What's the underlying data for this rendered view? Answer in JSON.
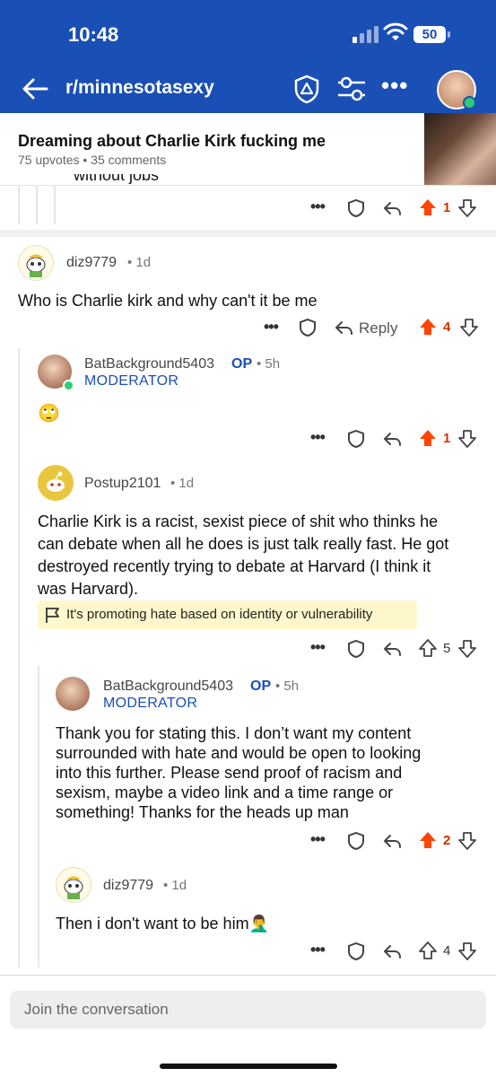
{
  "status_bar": {
    "time": "10:48",
    "battery": "50"
  },
  "header": {
    "subreddit": "r/minnesotasexy"
  },
  "post": {
    "title": "Dreaming about Charlie Kirk fucking me",
    "meta": "75 upvotes • 35 comments"
  },
  "partial_comment": {
    "text": "without jobs",
    "votes": "1"
  },
  "comments": [
    {
      "user": "diz9779",
      "age": "• 1d",
      "text": "Who is Charlie kirk and why can't it be me",
      "reply_label": "Reply",
      "votes": "4"
    },
    {
      "user": "BatBackground5403",
      "op": "OP",
      "age": "• 5h",
      "flair": "MODERATOR",
      "text": "🙄",
      "votes": "1"
    },
    {
      "user": "Postup2101",
      "age": "• 1d",
      "text_lines": [
        "Charlie Kirk is a racist, sexist piece of shit who thinks he",
        "can debate when all he does is just talk really fast. He got",
        "destroyed recently trying to debate at Harvard (I think it",
        "was Harvard)."
      ],
      "reason": "It's promoting hate based on identity or vulnerability",
      "votes": "5"
    },
    {
      "user": "BatBackground5403",
      "op": "OP",
      "age": "• 5h",
      "flair": "MODERATOR",
      "text_lines": [
        "Thank you for stating this.  I don’t want my content",
        "surrounded with hate and would be open to looking",
        "into this further.  Please send proof of racism and",
        "sexism, maybe a video link and a time range or",
        "something! Thanks for the heads up man"
      ],
      "votes": "2"
    },
    {
      "user": "diz9779",
      "age": "• 1d",
      "text": "Then i don't want to be him🤦‍♂️",
      "votes": "4"
    }
  ],
  "composer": {
    "placeholder": "Join the conversation"
  },
  "colors": {
    "header_blue": "#1a4fb5",
    "upvote_orange": "#ff4500",
    "mod_blue": "#1a4fb5",
    "reason_bg": "#fff7cc"
  }
}
